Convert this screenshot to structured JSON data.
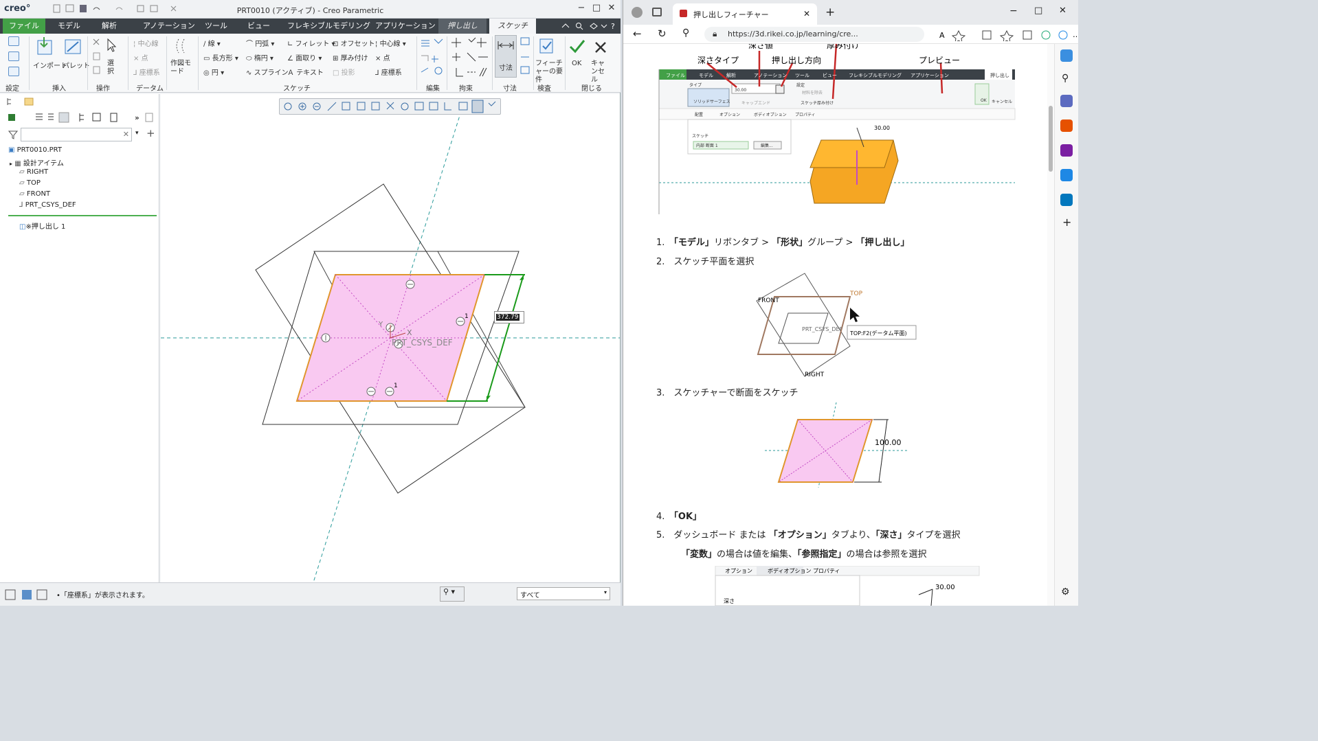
{
  "creo": {
    "logo": "creo°",
    "window_title": "PRT0010 (アクティブ) - Creo Parametric",
    "menu_tabs": [
      "ファイル",
      "モデル",
      "解析",
      "アノテーション",
      "ツール",
      "ビュー",
      "フレキシブルモデリング",
      "アプリケーション"
    ],
    "context_tabs": [
      "押し出し",
      "スケッチ"
    ],
    "ribbon": {
      "setup": "設定",
      "insert_group": "挿入",
      "insert_import": "インポート",
      "insert_palette": "パレット",
      "select": "選択",
      "ops_group": "操作",
      "datum_group": "データム",
      "datum_items": [
        "中心線",
        "点",
        "座標系"
      ],
      "construction_mode": "作図モード",
      "sketch_group": "スケッチ",
      "sketch_items": [
        "線",
        "長方形",
        "円",
        "円弧",
        "楕円",
        "スプライン",
        "フィレット",
        "面取り",
        "テキスト",
        "オフセット",
        "厚み付け",
        "投影",
        "中心線",
        "点",
        "座標系"
      ],
      "edit_group": "編集",
      "constrain_group": "拘束",
      "dimension_label": "寸法",
      "dimension_group": "寸法",
      "feature_req": "フィーチャーの要件",
      "inspect_group": "検査",
      "ok": "OK",
      "cancel": "キャンセル",
      "close_group": "閉じる"
    },
    "tree": {
      "root": "PRT0010.PRT",
      "items": [
        "設計アイテム",
        "RIGHT",
        "TOP",
        "FRONT",
        "PRT_CSYS_DEF"
      ],
      "feature": "※押し出し 1"
    },
    "graphics": {
      "dimension_value": "372.79",
      "csys_label": "PRT_CSYS_DEF",
      "constraint_label": "1",
      "axis_x": "X",
      "axis_y": "Y"
    },
    "status_message": "•「座標系」が表示されます。",
    "filter_value": "すべて",
    "colors": {
      "file_tab": "#43a047",
      "sketch_fill": "#f9c9f1",
      "sketch_edge": "#e0962c",
      "dimension": "#1a9a1a"
    }
  },
  "browser": {
    "tab_title": "押し出しフィーチャー",
    "url": "https://3d.rikei.co.jp/learning/cre...",
    "figure1": {
      "callouts": [
        "深さタイプ",
        "深さ値",
        "押し出し方向",
        "厚み付け",
        "プレビュー"
      ],
      "tabs": [
        "ファイル",
        "モデル",
        "解析",
        "アノテーション",
        "ツール",
        "ビュー",
        "フレキシブルモデリング",
        "アプリケーション",
        "押し出し"
      ],
      "type_label": "タイプ",
      "solid": "ソリッド",
      "surface": "サーフェス",
      "depth_value": "30.00",
      "settings_label": "設定",
      "remove_material": "材料を除去",
      "cap_ends": "キャップエンド",
      "thicken_sketch": "スケッチ厚み付け",
      "subtabs": [
        "配置",
        "オプション",
        "ボディオプション",
        "プロパティ"
      ],
      "sketch_label": "スケッチ",
      "section_name": "内部 断面 1",
      "edit_button": "編集...",
      "ok": "OK",
      "cancel": "キャンセル",
      "dim_30": "30.00"
    },
    "steps": [
      {
        "num": "1.",
        "parts": [
          "「モデル」",
          "リボンタブ > ",
          "「形状」",
          "グループ > ",
          "「押し出し」"
        ]
      },
      {
        "num": "2.",
        "text": "スケッチ平面を選択"
      },
      {
        "num": "3.",
        "text": "スケッチャーで断面をスケッチ"
      },
      {
        "num": "4.",
        "text": "「OK」"
      },
      {
        "num": "5.",
        "parts": [
          "ダッシュボード または ",
          "「オプション」",
          "タブより、",
          "「深さ」",
          "タイプを選択"
        ]
      }
    ],
    "step5_note": [
      "「変数」",
      "の場合は値を編集、",
      "「参照指定」",
      "の場合は参照を選択"
    ],
    "figure2": {
      "front": "FRONT",
      "top": "TOP",
      "right": "RIGHT",
      "csys": "PRT_CSYS_DEF",
      "tooltip": "TOP:F2(データム平面)"
    },
    "figure3": {
      "dim": "100.00"
    },
    "figure4": {
      "tabs": [
        "オプション",
        "ボディオプション",
        "プロパティ"
      ],
      "depth_label": "深さ",
      "dim": "30.00"
    }
  }
}
